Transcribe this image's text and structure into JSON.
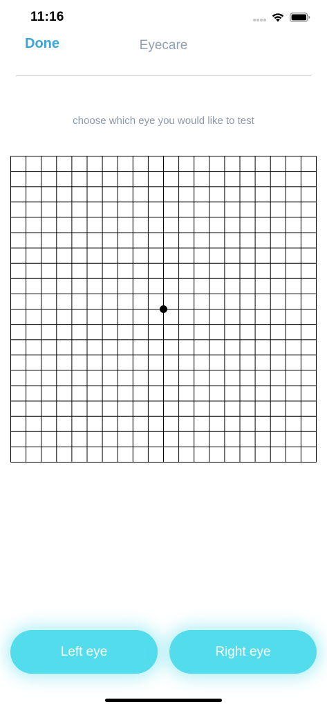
{
  "status_bar": {
    "time": "11:16",
    "icons": [
      "cellular-signal-icon",
      "wifi-icon",
      "battery-icon"
    ]
  },
  "nav": {
    "done_label": "Done",
    "title": "Eyecare"
  },
  "instruction": "choose which eye you would like to test",
  "amsler_grid": {
    "rows": 20,
    "columns": 20,
    "center_dot": true
  },
  "buttons": {
    "left_eye_label": "Left eye",
    "right_eye_label": "Right eye"
  },
  "colors": {
    "accent": "#3aa4db",
    "title": "#8fa0b4",
    "button_bg": "#52dcec",
    "grid_line": "#000000"
  }
}
